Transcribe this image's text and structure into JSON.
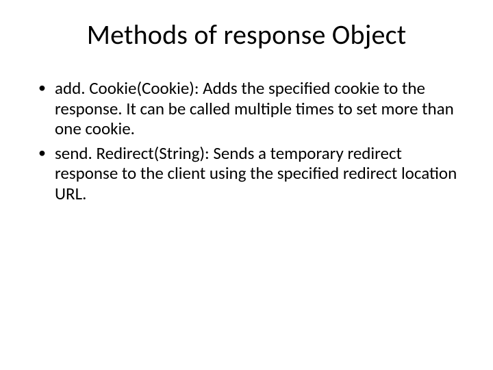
{
  "title": "Methods of response Object",
  "bullets": [
    "add. Cookie(Cookie):  Adds the specified cookie to the response. It can be called multiple times to set more than one cookie.",
    "send. Redirect(String): Sends a temporary redirect response to the client using the specified redirect location URL."
  ]
}
